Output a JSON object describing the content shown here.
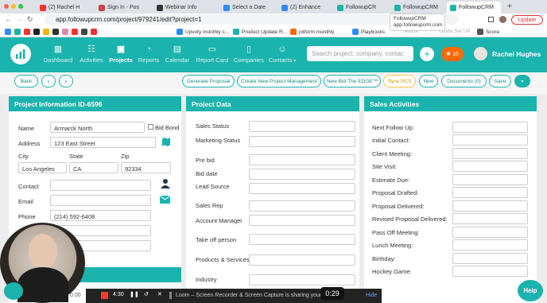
{
  "browser": {
    "tabs": [
      {
        "label": "(2) Rachel H",
        "color": "#e33"
      },
      {
        "label": "Sign In - Pos",
        "color": "#c44"
      },
      {
        "label": "Webinar Info",
        "color": "#333"
      },
      {
        "label": "Select a Date",
        "color": "#2d8cff"
      },
      {
        "label": "(2) Enhance",
        "color": "#2d8cff"
      },
      {
        "label": "FollowupCR",
        "color": "#1bb3ad"
      },
      {
        "label": "FollowupCRM",
        "color": "#1bb3ad"
      },
      {
        "label": "FollowupCRM",
        "color": "#1bb3ad"
      }
    ],
    "tab_tooltip": "FollowupCRM\napp.followupcrm.com",
    "url": "app.followupcrm.com/project/979241/edit?project=1",
    "update_label": "Update",
    "bookmarks": [
      "Upvoty monthly c...",
      "Product Update R...",
      "jotform monthly",
      "Playbooks",
      "Article",
      "Guido Set UP",
      "Score"
    ]
  },
  "nav": {
    "items": [
      {
        "label": "Dashboard",
        "icon": "dashboard-icon"
      },
      {
        "label": "Activities",
        "icon": "activities-icon"
      },
      {
        "label": "Projects",
        "icon": "projects-icon"
      },
      {
        "label": "Reports",
        "icon": "reports-icon"
      },
      {
        "label": "Calendar",
        "icon": "calendar-icon"
      },
      {
        "label": "Report Card",
        "icon": "report-card-icon"
      },
      {
        "label": "Companies",
        "icon": "companies-icon"
      },
      {
        "label": "Contacts",
        "icon": "contacts-icon"
      }
    ],
    "search_placeholder": "Search project, company, contac",
    "notification_count": "10",
    "user_name": "Rachel Hughes"
  },
  "toolbar": {
    "back": "Back",
    "buttons": [
      "Generate Proposal",
      "Create New Project Management",
      "New Bid-The EDGE™",
      "Sync PCS",
      "New",
      "Documents (0)",
      "Save"
    ]
  },
  "project_info": {
    "title": "Project Information ID-6596",
    "name_label": "Name",
    "name_value": "Armarck North",
    "bid_bond_label": "Bid Bond",
    "address_label": "Address",
    "address_value": "123 East Street",
    "city_label": "City",
    "state_label": "State",
    "zip_label": "Zip",
    "city_value": "Los Angeles",
    "state_value": "CA",
    "zip_value": "92334",
    "contact_label": "Contact",
    "email_label": "Email",
    "phone_label": "Phone",
    "phone_value": "(214) 592-6408"
  },
  "project_data": {
    "title": "Project Data",
    "fields": [
      "Sales Status",
      "Marketing Status",
      "Pre bid",
      "Bid date",
      "Lead Source",
      "Sales Rep",
      "Account Manager",
      "Take off person",
      "Products & Services",
      "Industry"
    ]
  },
  "sales_activities": {
    "title": "Sales Activities",
    "fields": [
      "Next Follow Up:",
      "Initial Contact:",
      "Client Meeting:",
      "Site Visit:",
      "Estimate Due:",
      "Proposal Drafted:",
      "Proposal Delivered:",
      "Revised Proposal Delivered:",
      "Pass Off Meeting:",
      "Lunch Meeting:",
      "Birthday:",
      "Hockey Game:"
    ]
  },
  "loom": {
    "elapsed": "4:30",
    "countdown": "0:29",
    "share_text": "Loom – Screen Recorder & Screen Capture is sharing your screen.",
    "hide": "Hide",
    "time_left": "0.00"
  },
  "help_label": "Help",
  "colors": {
    "accent": "#1bb3ad",
    "notification": "#ff6a00"
  }
}
